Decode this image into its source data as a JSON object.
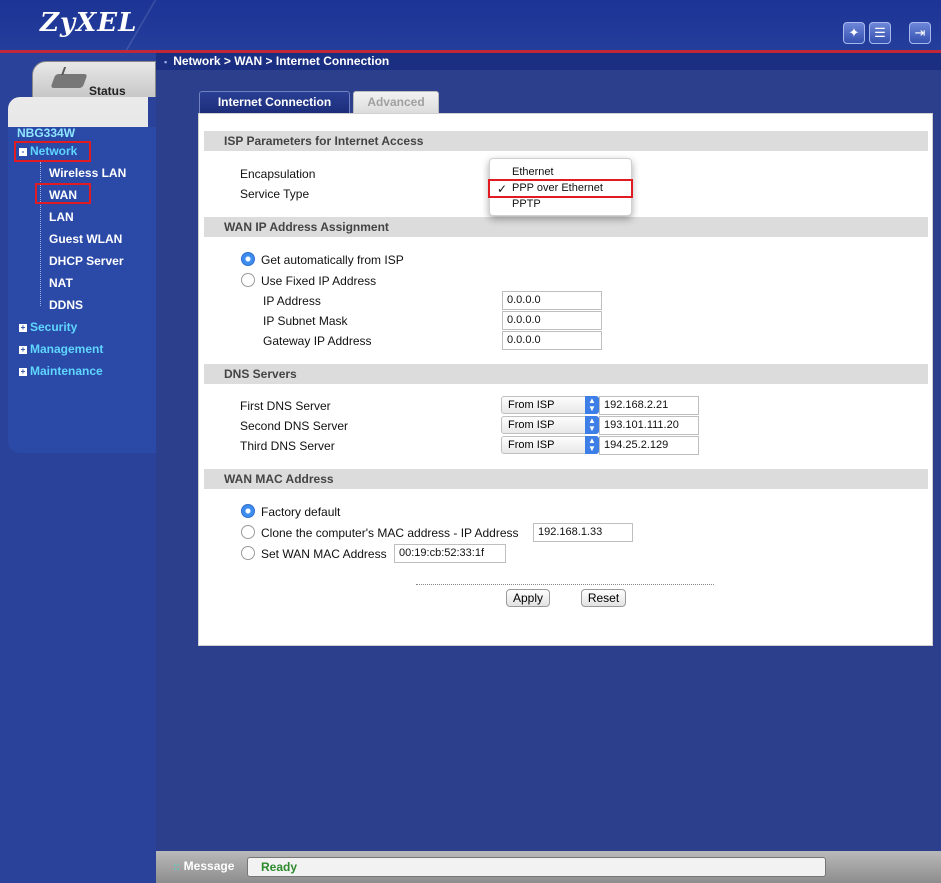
{
  "app": {
    "logo": "ZyXEL"
  },
  "header": {
    "buttons": [
      {
        "icon": "wizard-icon"
      },
      {
        "icon": "notes-icon"
      },
      {
        "icon": "logout-icon"
      }
    ]
  },
  "breadcrumb": "Network > WAN > Internet Connection",
  "sidebar": {
    "status_tab": "Status",
    "device": "NBG334W",
    "items": [
      {
        "label": "Network",
        "expand": "-"
      },
      {
        "label": "Wireless LAN"
      },
      {
        "label": "WAN"
      },
      {
        "label": "LAN"
      },
      {
        "label": "Guest WLAN"
      },
      {
        "label": "DHCP Server"
      },
      {
        "label": "NAT"
      },
      {
        "label": "DDNS"
      },
      {
        "label": "Security",
        "expand": "+"
      },
      {
        "label": "Management",
        "expand": "+"
      },
      {
        "label": "Maintenance",
        "expand": "+"
      }
    ],
    "highlight_color": "#e01b22"
  },
  "tabs": [
    {
      "label": "Internet Connection",
      "active": true
    },
    {
      "label": "Advanced",
      "active": false
    }
  ],
  "isp": {
    "heading": "ISP Parameters for Internet Access",
    "encapsulation_label": "Encapsulation",
    "service_type_label": "Service Type",
    "dropdown": {
      "options": [
        "Ethernet",
        "PPP over Ethernet",
        "PPTP"
      ],
      "selected": "PPP over Ethernet",
      "check": "✓"
    }
  },
  "wan_ip": {
    "heading": "WAN IP Address Assignment",
    "auto_label": "Get automatically from ISP",
    "fixed_label": "Use Fixed IP Address",
    "selected": "auto",
    "ip_label": "IP Address",
    "ip_value": "0.0.0.0",
    "mask_label": "IP Subnet Mask",
    "mask_value": "0.0.0.0",
    "gateway_label": "Gateway IP Address",
    "gateway_value": "0.0.0.0"
  },
  "dns": {
    "heading": "DNS Servers",
    "rows": [
      {
        "label": "First DNS Server",
        "mode": "From ISP",
        "value": "192.168.2.21"
      },
      {
        "label": "Second DNS Server",
        "mode": "From ISP",
        "value": "193.101.111.20"
      },
      {
        "label": "Third DNS Server",
        "mode": "From ISP",
        "value": "194.25.2.129"
      }
    ]
  },
  "mac": {
    "heading": "WAN MAC Address",
    "factory_label": "Factory default",
    "clone_label": "Clone the computer's MAC address - IP Address",
    "clone_ip": "192.168.1.33",
    "set_label": "Set WAN MAC Address",
    "set_value": "00:19:cb:52:33:1f",
    "selected": "factory"
  },
  "buttons": {
    "apply": "Apply",
    "reset": "Reset"
  },
  "statusbar": {
    "title": "Message",
    "message": "Ready"
  }
}
